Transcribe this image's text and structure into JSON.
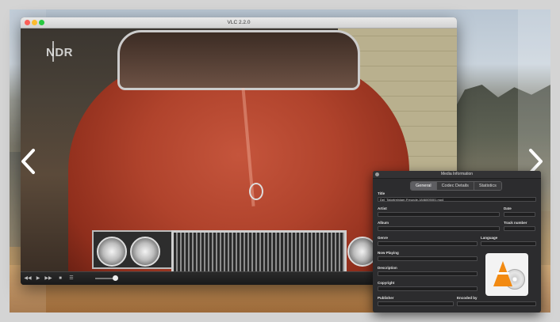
{
  "window": {
    "title": "VLC 2.2.0"
  },
  "video": {
    "channel_logo": "NDR"
  },
  "controls": {
    "rewind_icon": "rewind-icon",
    "play_icon": "play-icon",
    "forward_icon": "fast-forward-icon",
    "stop_icon": "stop-icon",
    "playlist_icon": "playlist-icon",
    "glyphs": {
      "rewind": "◀◀",
      "play": "▶",
      "forward": "▶▶",
      "stop": "■",
      "playlist": "☰"
    }
  },
  "navigation": {
    "prev_icon": "chevron-left-icon",
    "next_icon": "chevron-right-icon"
  },
  "media_info": {
    "title": "Media Information",
    "tabs": [
      {
        "label": "General",
        "active": true
      },
      {
        "label": "Codec Details",
        "active": false
      },
      {
        "label": "Statistics",
        "active": false
      }
    ],
    "fields": {
      "title_label": "Title",
      "title_value": "Del_Tatortreiniger-Freunde-1846005001.mp4",
      "artist_label": "Artist",
      "date_label": "Date",
      "album_label": "Album",
      "track_label": "Track number",
      "genre_label": "Genre",
      "language_label": "Language",
      "now_playing_label": "Now Playing",
      "description_label": "Description",
      "copyright_label": "Copyright",
      "publisher_label": "Publisher",
      "encoded_by_label": "Encoded by"
    },
    "artwork_icon": "vlc-cone-icon"
  },
  "colors": {
    "vlc_orange": "#f28a12",
    "panel_bg": "#2c2c2e",
    "car_red": "#b0432c"
  }
}
